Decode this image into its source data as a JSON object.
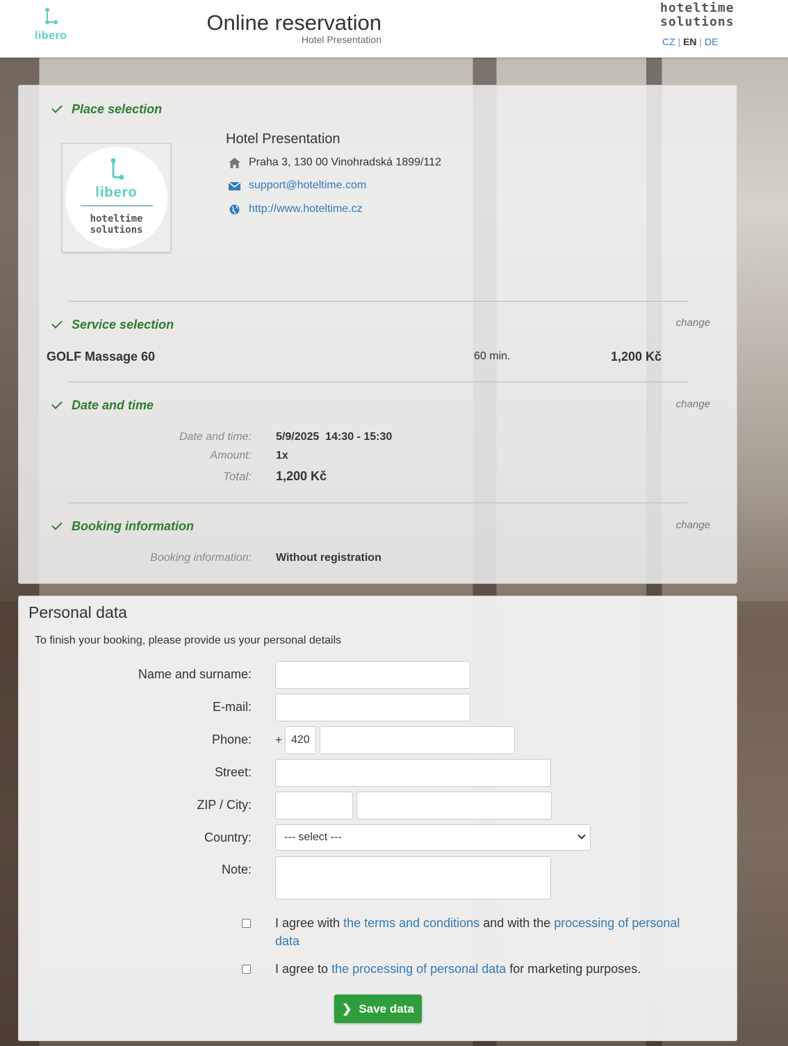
{
  "header": {
    "logo_text": "libero",
    "title": "Online reservation",
    "subtitle": "Hotel Presentation",
    "brand_line1": "hoteltime",
    "brand_line2": "solutions",
    "languages": [
      "CZ",
      "EN",
      "DE"
    ],
    "active_language": "EN"
  },
  "place": {
    "heading": "Place selection",
    "logo_text": "libero",
    "logo_brand1": "hoteltime",
    "logo_brand2": "solutions",
    "hotel_name": "Hotel Presentation",
    "address": "Praha 3, 130 00 Vinohradská 1899/112",
    "email": "support@hoteltime.com",
    "website": "http://www.hoteltime.cz"
  },
  "service": {
    "heading": "Service selection",
    "change": "change",
    "name": "GOLF Massage 60",
    "duration": "60 min.",
    "price": "1,200 Kč"
  },
  "datetime": {
    "heading": "Date and time",
    "change": "change",
    "date_label": "Date and time:",
    "date_value": "5/9/2025  14:30 - 15:30",
    "amount_label": "Amount:",
    "amount_value": "1x",
    "total_label": "Total:",
    "total_value": "1,200 Kč"
  },
  "booking": {
    "heading": "Booking information",
    "change": "change",
    "label": "Booking information:",
    "value": "Without registration"
  },
  "personal": {
    "title": "Personal data",
    "intro": "To finish your booking, please provide us your personal details",
    "name_label": "Name and surname:",
    "email_label": "E-mail:",
    "phone_label": "Phone:",
    "phone_plus": "+",
    "phone_prefix": "420",
    "street_label": "Street:",
    "zip_label": "ZIP / City:",
    "country_label": "Country:",
    "country_value": "--- select ---",
    "note_label": "Note:",
    "agree1_a": "I agree with ",
    "agree1_link1": "the terms and conditions",
    "agree1_b": " and with the ",
    "agree1_link2": "processing of personal data",
    "agree2_a": "I agree to ",
    "agree2_link": "the processing of personal data",
    "agree2_b": " for marketing purposes.",
    "save": "Save data"
  },
  "colors": {
    "accent_green": "#2e7d32",
    "link": "#337ab7",
    "button": "#2f9e3a",
    "brand_teal": "#5ccfc3"
  }
}
